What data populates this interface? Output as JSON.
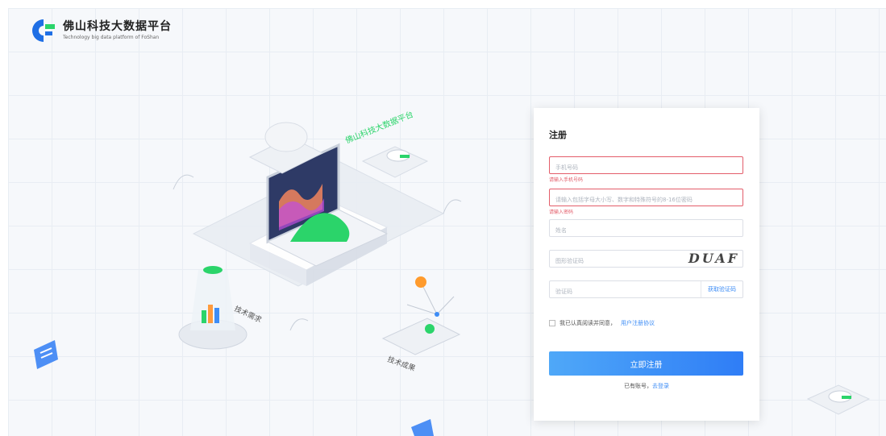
{
  "brand": {
    "title": "佛山科技大数据平台",
    "subtitle": "Technology big data platform of FoShan"
  },
  "illustration": {
    "platform_label": "佛山科技大数据平台",
    "tech_demand_label": "技术需求",
    "tech_result_label": "技术成果"
  },
  "form": {
    "title": "注册",
    "phone_placeholder": "手机号码",
    "phone_error": "请输入手机号码",
    "password_placeholder": "请输入包括字母大小写、数字和特殊符号的8-16位密码",
    "password_error": "请输入密码",
    "name_placeholder": "姓名",
    "captcha_placeholder": "图形验证码",
    "captcha_text": "DUAF",
    "sms_placeholder": "验证码",
    "sms_button": "获取验证码",
    "agree_text": "我已认真阅读并同意，",
    "agree_link": "用户注册协议",
    "submit_label": "立即注册",
    "login_prompt": "已有账号，",
    "login_link": "去登录"
  },
  "colors": {
    "accent": "#3e8df6",
    "error": "#e35d6a",
    "green": "#2bd46a"
  }
}
